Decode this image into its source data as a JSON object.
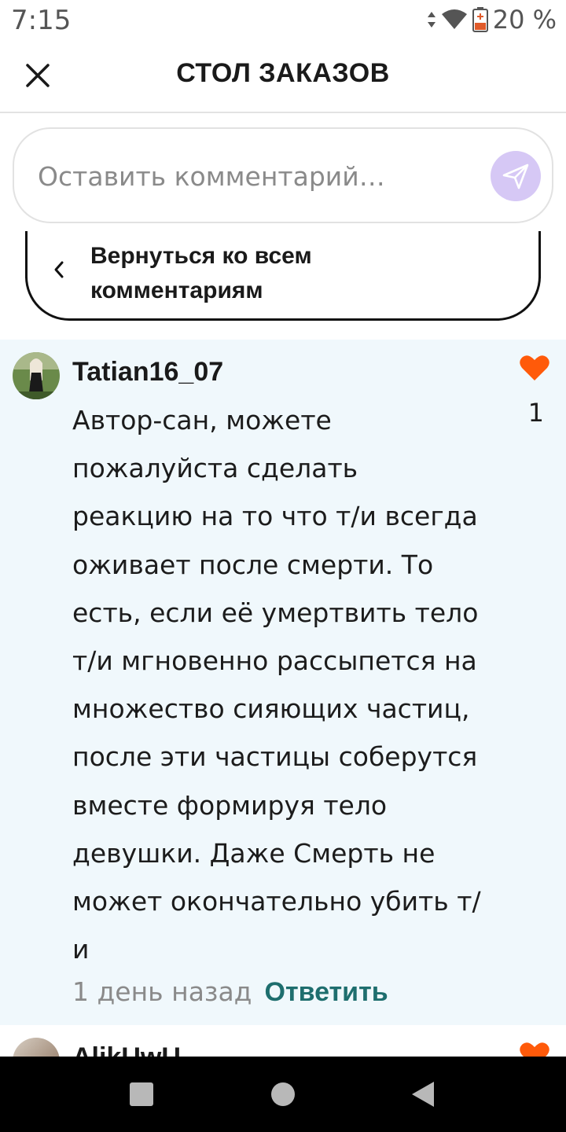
{
  "status_bar": {
    "time": "7:15",
    "battery_percent": "20 %"
  },
  "header": {
    "title": "СТОЛ ЗАКАЗОВ",
    "close_icon": "close-icon"
  },
  "comment_input": {
    "placeholder": "Оставить комментарий…",
    "send_icon": "send-icon",
    "send_color": "#d6c8f5"
  },
  "back_button": {
    "label": "Вернуться ко всем комментариям"
  },
  "comments": [
    {
      "username": "Tatian16_07",
      "text": "Автор-сан, можете пожалуйста сделать реакцию на то что т/и всегда оживает после смерти. То есть, если её умертвить тело т/и мгновенно рассыпется на множество сияющих частиц, после эти частицы соберутся вместе формируя тело девушки. Даже Смерть не может окончательно убить т/и",
      "likes": "1",
      "time": "1 день назад",
      "reply_label": "Ответить"
    },
    {
      "username": "AlikUwU"
    }
  ],
  "colors": {
    "accent_reply": "#1e6e6e",
    "like_heart": "#ff5a0a",
    "comment_bg": "#f0f8fc"
  }
}
